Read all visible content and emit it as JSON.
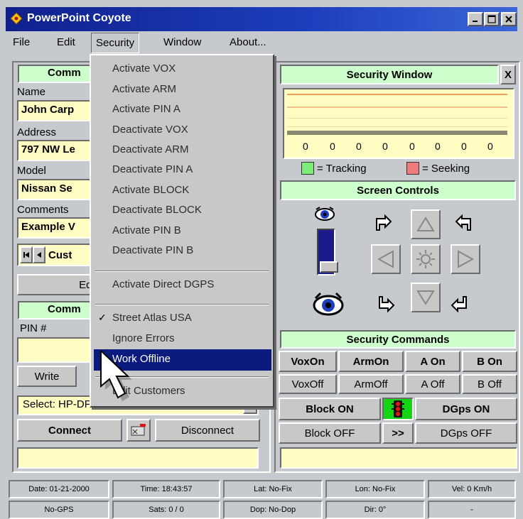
{
  "window": {
    "title": "PowerPoint Coyote"
  },
  "menubar": {
    "items": [
      {
        "label": "File"
      },
      {
        "label": "Edit"
      },
      {
        "label": "Security"
      },
      {
        "label": "Window"
      },
      {
        "label": "About..."
      }
    ]
  },
  "security_menu": {
    "items": [
      "Activate VOX",
      "Activate ARM",
      "Activate PIN A",
      "Deactivate VOX",
      "Deactivate ARM",
      "Deactivate PIN A",
      "Activate BLOCK",
      "Deactivate BLOCK",
      "Activate PIN B",
      "Deactivate PIN B"
    ],
    "direct_dgps": "Activate Direct DGPS",
    "street_atlas": "Street Atlas USA",
    "ignore_errors": "Ignore Errors",
    "work_offline": "Work Offline",
    "edit_customers": "Edit Customers",
    "check_mark": "✓"
  },
  "left_panel": {
    "comm_header": "Comm",
    "name_label": "Name",
    "name_value": "John Carp",
    "address_label": "Address",
    "address_value": "797 NW Le",
    "model_label": "Model",
    "model_value": "Nissan Se",
    "comments_label": "Comments",
    "comments_value": "Example V",
    "nav_value": "Cust",
    "edit_button": "Edit",
    "comm2_header": "Comm",
    "pin_label": "PIN #",
    "write_button": "Write",
    "select_value": "Select: HP-DP-3",
    "connect_button": "Connect",
    "disconnect_button": "Disconnect"
  },
  "security_window": {
    "title": "Security Window",
    "close_label": "X",
    "meter_values": [
      "0",
      "0",
      "0",
      "0",
      "0",
      "0",
      "0",
      "0"
    ],
    "legend_tracking": "= Tracking",
    "legend_seeking": "= Seeking",
    "tracking_color": "#7dec78",
    "seeking_color": "#f07a7a",
    "screen_controls": "Screen Controls",
    "security_commands": "Security Commands",
    "vox_on": "VoxOn",
    "arm_on": "ArmOn",
    "a_on": "A On",
    "b_on": "B On",
    "vox_off": "VoxOff",
    "arm_off": "ArmOff",
    "a_off": "A Off",
    "b_off": "B Off",
    "block_on": "Block ON",
    "dgps_on": "DGps ON",
    "block_off": "Block OFF",
    "next": ">>",
    "dgps_off": "DGps OFF"
  },
  "status": {
    "date": "Date: 01-21-2000",
    "time": "Time: 18:43:57",
    "lat": "Lat: No-Fix",
    "lon": "Lon: No-Fix",
    "vel": "Vel: 0 Km/h",
    "gps": "No-GPS",
    "sats": "Sats: 0 / 0",
    "dop": "Dop: No-Dop",
    "dir": "Dir: 0°",
    "blank": "-"
  }
}
